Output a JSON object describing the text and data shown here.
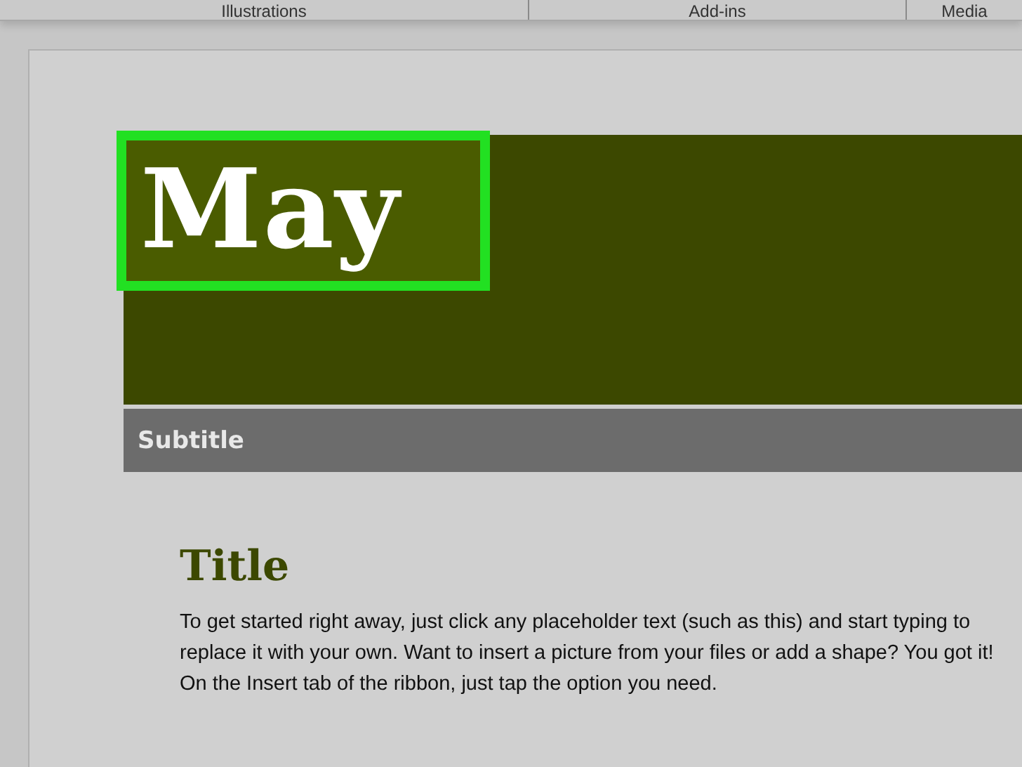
{
  "ribbon_groups": [
    {
      "label": "Illustrations"
    },
    {
      "label": "Add-ins"
    },
    {
      "label": "Media"
    }
  ],
  "document": {
    "banner_title": {
      "text": "May",
      "selected": true
    },
    "subtitle": "Subtitle",
    "title": "Title",
    "body": "To get started right away, just click any placeholder text (such as this) and start typing to replace it with your own. Want to insert a picture from your files or add a shape? You got it! On the Insert tab of the ribbon, just tap the option you need."
  }
}
